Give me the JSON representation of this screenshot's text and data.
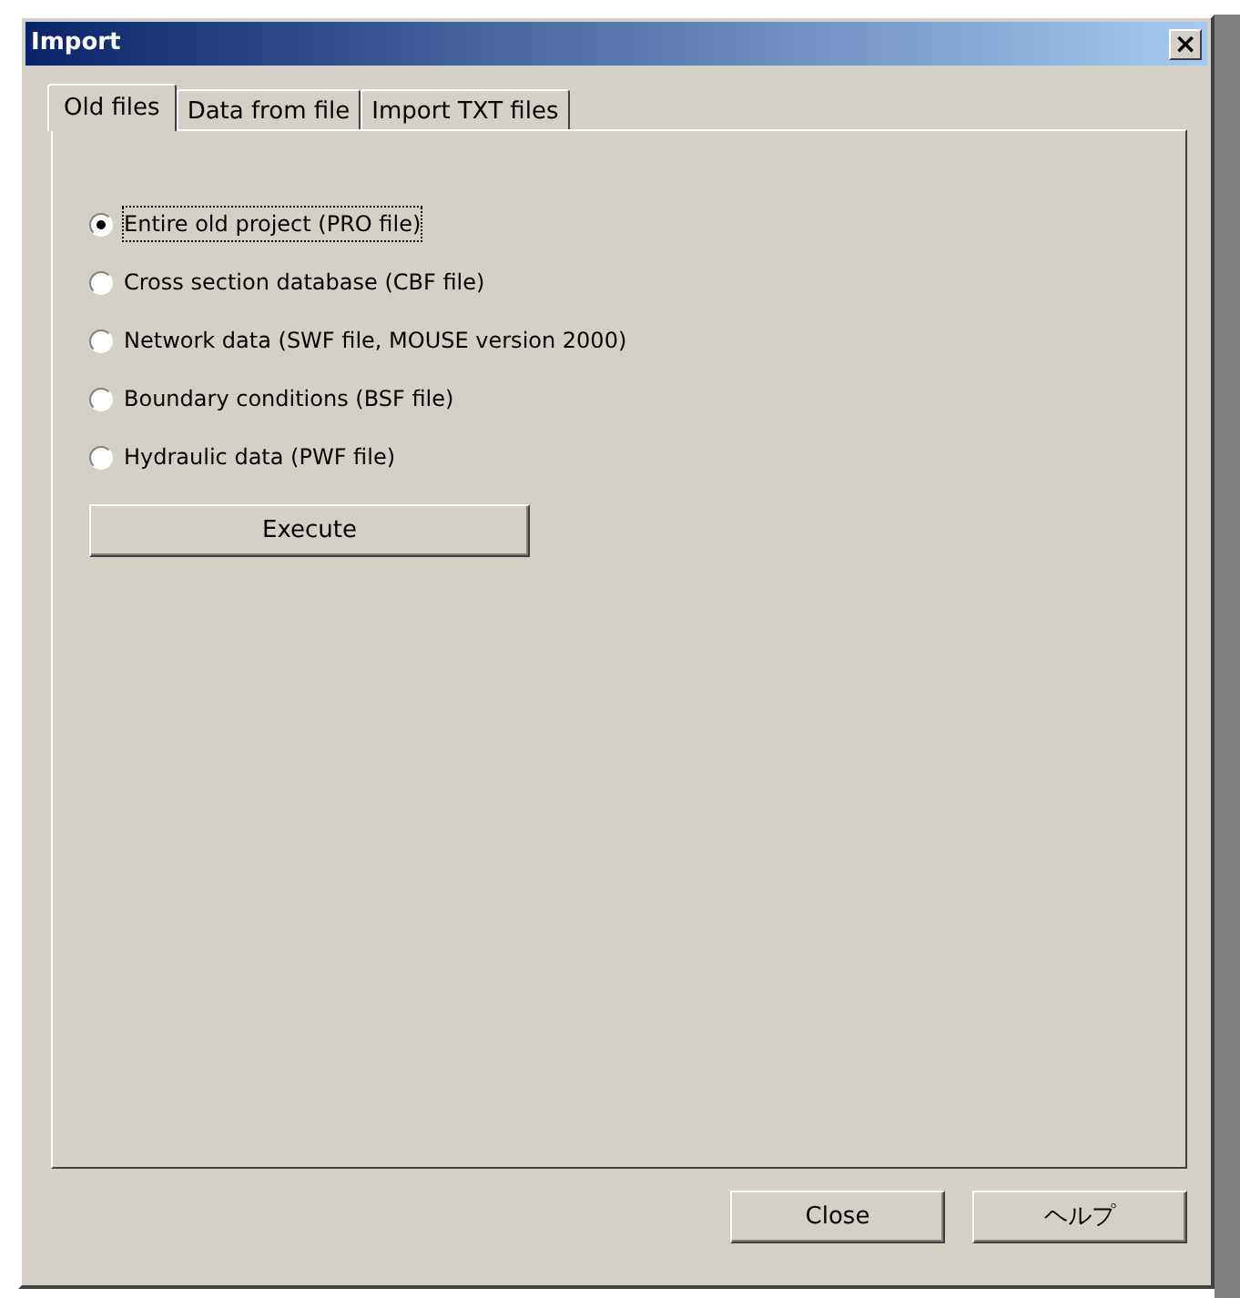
{
  "window": {
    "title": "Import",
    "close_glyph": "×"
  },
  "tabs": [
    {
      "label": "Old files",
      "selected": true
    },
    {
      "label": "Data from file",
      "selected": false
    },
    {
      "label": "Import TXT files",
      "selected": false
    }
  ],
  "options": [
    {
      "label": "Entire old project (PRO file)",
      "selected": true
    },
    {
      "label": "Cross section database (CBF file)",
      "selected": false
    },
    {
      "label": "Network data (SWF file, MOUSE version 2000)",
      "selected": false
    },
    {
      "label": "Boundary conditions (BSF file)",
      "selected": false
    },
    {
      "label": "Hydraulic data (PWF file)",
      "selected": false
    }
  ],
  "execute_button": "Execute",
  "buttons": [
    "Close",
    "ヘルプ"
  ]
}
